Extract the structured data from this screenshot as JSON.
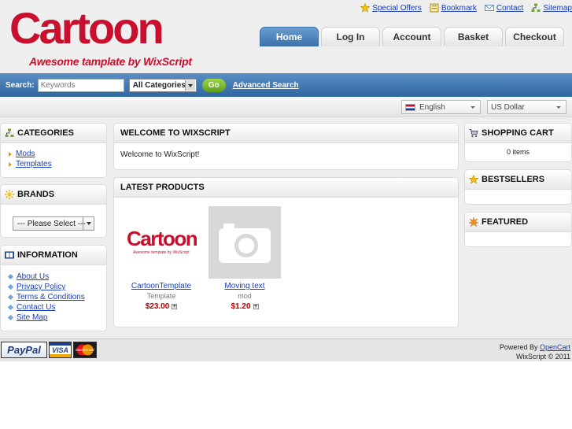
{
  "logo": {
    "main": "Cartoon",
    "tagline": "Awesome tamplate by WixScript"
  },
  "toplinks": [
    {
      "label": "Special Offers",
      "icon": "star-icon"
    },
    {
      "label": "Bookmark",
      "icon": "bookmark-icon"
    },
    {
      "label": "Contact",
      "icon": "mail-icon"
    },
    {
      "label": "Sitemap",
      "icon": "sitemap-icon"
    }
  ],
  "nav": [
    "Home",
    "Log In",
    "Account",
    "Basket",
    "Checkout"
  ],
  "search": {
    "label": "Search:",
    "placeholder": "Keywords",
    "category": "All Categories",
    "go": "Go",
    "advanced": "Advanced Search"
  },
  "language": "English",
  "currency": "US Dollar",
  "categories": {
    "title": "CATEGORIES",
    "items": [
      "Mods",
      "Templates"
    ]
  },
  "brands": {
    "title": "BRANDS",
    "select": "--- Please Select ---"
  },
  "information": {
    "title": "INFORMATION",
    "items": [
      "About Us",
      "Privacy Policy",
      "Terms & Conditions",
      "Contact Us",
      "Site Map"
    ]
  },
  "welcome": {
    "title": "WELCOME TO WIXSCRIPT",
    "text": "Welcome to WixScript!"
  },
  "latest": {
    "title": "LATEST PRODUCTS",
    "products": [
      {
        "name": "CartoonTemplate",
        "model": "Template",
        "price": "$23.00",
        "img_main": "Cartoon",
        "img_tag": "Awesome template by WixScript"
      },
      {
        "name": "Moving text",
        "model": "mod",
        "price": "$1.20"
      }
    ]
  },
  "cart": {
    "title": "SHOPPING CART",
    "text": "0 items"
  },
  "bestsellers": {
    "title": "BESTSELLERS"
  },
  "featured": {
    "title": "FEATURED"
  },
  "footer": {
    "payments": [
      "PayPal",
      "VISA",
      "MasterCard"
    ],
    "powered_by": "Powered By",
    "powered_link": "OpenCart",
    "copyright": "WixScript © 2011"
  },
  "colors": {
    "brand_red": "#c8102e",
    "nav_blue": "#3a6fa8",
    "price_red": "#b30000",
    "link_blue": "#1a3fb5"
  }
}
